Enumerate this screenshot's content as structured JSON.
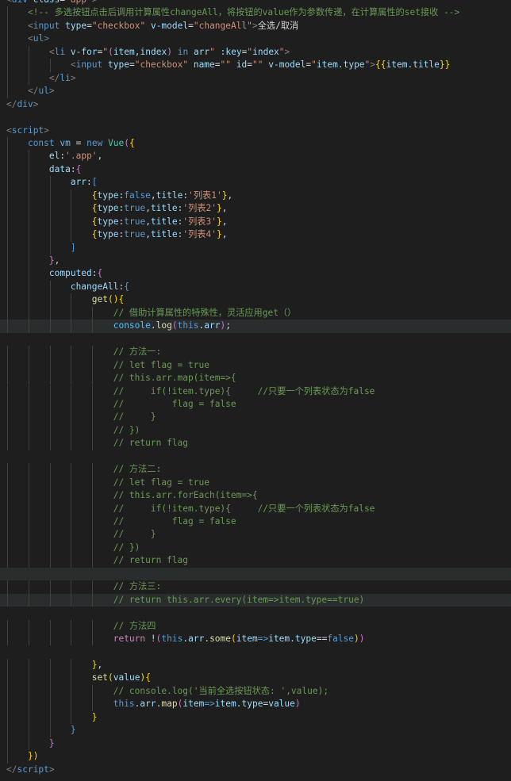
{
  "editor": {
    "theme_background": "#1e1e1e",
    "lines": [
      [
        [
          "t-bracket",
          "<"
        ],
        [
          "t-tag",
          "div"
        ],
        [
          "t-default",
          " "
        ],
        [
          "t-attr",
          "class"
        ],
        [
          "t-default",
          "="
        ],
        [
          "t-str",
          "\"app\""
        ],
        [
          "t-bracket",
          ">"
        ]
      ],
      [
        [
          "t-default",
          "    "
        ],
        [
          "t-comment",
          "<!-- 多选按钮点击后调用计算属性changeAll，将按钮的value作为参数传递，在计算属性的set接收 -->"
        ]
      ],
      [
        [
          "t-default",
          "    "
        ],
        [
          "t-bracket",
          "<"
        ],
        [
          "t-tag",
          "input"
        ],
        [
          "t-default",
          " "
        ],
        [
          "t-attr",
          "type"
        ],
        [
          "t-default",
          "="
        ],
        [
          "t-str",
          "\"checkbox\""
        ],
        [
          "t-default",
          " "
        ],
        [
          "t-attr",
          "v-model"
        ],
        [
          "t-default",
          "="
        ],
        [
          "t-str",
          "\"changeAll\""
        ],
        [
          "t-bracket",
          ">"
        ],
        [
          "t-text",
          "全选/取消"
        ]
      ],
      [
        [
          "t-default",
          "    "
        ],
        [
          "t-bracket",
          "<"
        ],
        [
          "t-tag",
          "ul"
        ],
        [
          "t-bracket",
          ">"
        ]
      ],
      [
        [
          "t-default",
          "        "
        ],
        [
          "t-bracket",
          "<"
        ],
        [
          "t-tag",
          "li"
        ],
        [
          "t-default",
          " "
        ],
        [
          "t-attr",
          "v-for"
        ],
        [
          "t-default",
          "="
        ],
        [
          "t-str",
          "\""
        ],
        [
          "t-paren",
          "("
        ],
        [
          "t-var",
          "item"
        ],
        [
          "t-punc",
          ","
        ],
        [
          "t-var",
          "index"
        ],
        [
          "t-paren",
          ")"
        ],
        [
          "t-default",
          " "
        ],
        [
          "t-keyword",
          "in"
        ],
        [
          "t-default",
          " "
        ],
        [
          "t-var",
          "arr"
        ],
        [
          "t-str",
          "\""
        ],
        [
          "t-default",
          " "
        ],
        [
          "t-attr",
          ":key"
        ],
        [
          "t-default",
          "="
        ],
        [
          "t-str",
          "\""
        ],
        [
          "t-var",
          "index"
        ],
        [
          "t-str",
          "\""
        ],
        [
          "t-bracket",
          ">"
        ]
      ],
      [
        [
          "t-default",
          "            "
        ],
        [
          "t-bracket",
          "<"
        ],
        [
          "t-tag",
          "input"
        ],
        [
          "t-default",
          " "
        ],
        [
          "t-attr",
          "type"
        ],
        [
          "t-default",
          "="
        ],
        [
          "t-str",
          "\"checkbox\""
        ],
        [
          "t-default",
          " "
        ],
        [
          "t-attr",
          "name"
        ],
        [
          "t-default",
          "="
        ],
        [
          "t-str",
          "\"\""
        ],
        [
          "t-default",
          " "
        ],
        [
          "t-attr",
          "id"
        ],
        [
          "t-default",
          "="
        ],
        [
          "t-str",
          "\"\""
        ],
        [
          "t-default",
          " "
        ],
        [
          "t-attr",
          "v-model"
        ],
        [
          "t-default",
          "="
        ],
        [
          "t-str",
          "\""
        ],
        [
          "t-var",
          "item"
        ],
        [
          "t-punc",
          "."
        ],
        [
          "t-prop",
          "type"
        ],
        [
          "t-str",
          "\""
        ],
        [
          "t-bracket",
          ">"
        ],
        [
          "t-brace",
          "{{"
        ],
        [
          "t-var",
          "item"
        ],
        [
          "t-punc",
          "."
        ],
        [
          "t-prop",
          "title"
        ],
        [
          "t-brace",
          "}}"
        ]
      ],
      [
        [
          "t-default",
          "        "
        ],
        [
          "t-bracket",
          "</"
        ],
        [
          "t-tag",
          "li"
        ],
        [
          "t-bracket",
          ">"
        ]
      ],
      [
        [
          "t-default",
          "    "
        ],
        [
          "t-bracket",
          "</"
        ],
        [
          "t-tag",
          "ul"
        ],
        [
          "t-bracket",
          ">"
        ]
      ],
      [
        [
          "t-bracket",
          "</"
        ],
        [
          "t-tag",
          "div"
        ],
        [
          "t-bracket",
          ">"
        ]
      ],
      [],
      [
        [
          "t-bracket",
          "<"
        ],
        [
          "t-tag",
          "script"
        ],
        [
          "t-bracket",
          ">"
        ]
      ],
      [
        [
          "t-default",
          "    "
        ],
        [
          "t-keyword",
          "const"
        ],
        [
          "t-default",
          " "
        ],
        [
          "t-const",
          "vm"
        ],
        [
          "t-default",
          " = "
        ],
        [
          "t-keyword",
          "new"
        ],
        [
          "t-default",
          " "
        ],
        [
          "t-class",
          "Vue"
        ],
        [
          "t-paren",
          "("
        ],
        [
          "t-brace",
          "{"
        ]
      ],
      [
        [
          "t-default",
          "        "
        ],
        [
          "t-prop",
          "el"
        ],
        [
          "t-punc",
          ":"
        ],
        [
          "t-str",
          "'.app'"
        ],
        [
          "t-punc",
          ","
        ]
      ],
      [
        [
          "t-default",
          "        "
        ],
        [
          "t-prop",
          "data"
        ],
        [
          "t-punc",
          ":"
        ],
        [
          "t-paren",
          "{"
        ]
      ],
      [
        [
          "t-default",
          "            "
        ],
        [
          "t-prop",
          "arr"
        ],
        [
          "t-punc",
          ":"
        ],
        [
          "t-tag",
          "["
        ]
      ],
      [
        [
          "t-default",
          "                "
        ],
        [
          "t-brace",
          "{"
        ],
        [
          "t-prop",
          "type"
        ],
        [
          "t-punc",
          ":"
        ],
        [
          "t-bool",
          "false"
        ],
        [
          "t-punc",
          ","
        ],
        [
          "t-prop",
          "title"
        ],
        [
          "t-punc",
          ":"
        ],
        [
          "t-str",
          "'列表1'"
        ],
        [
          "t-brace",
          "}"
        ],
        [
          "t-punc",
          ","
        ]
      ],
      [
        [
          "t-default",
          "                "
        ],
        [
          "t-brace",
          "{"
        ],
        [
          "t-prop",
          "type"
        ],
        [
          "t-punc",
          ":"
        ],
        [
          "t-bool",
          "true"
        ],
        [
          "t-punc",
          ","
        ],
        [
          "t-prop",
          "title"
        ],
        [
          "t-punc",
          ":"
        ],
        [
          "t-str",
          "'列表2'"
        ],
        [
          "t-brace",
          "}"
        ],
        [
          "t-punc",
          ","
        ]
      ],
      [
        [
          "t-default",
          "                "
        ],
        [
          "t-brace",
          "{"
        ],
        [
          "t-prop",
          "type"
        ],
        [
          "t-punc",
          ":"
        ],
        [
          "t-bool",
          "true"
        ],
        [
          "t-punc",
          ","
        ],
        [
          "t-prop",
          "title"
        ],
        [
          "t-punc",
          ":"
        ],
        [
          "t-str",
          "'列表3'"
        ],
        [
          "t-brace",
          "}"
        ],
        [
          "t-punc",
          ","
        ]
      ],
      [
        [
          "t-default",
          "                "
        ],
        [
          "t-brace",
          "{"
        ],
        [
          "t-prop",
          "type"
        ],
        [
          "t-punc",
          ":"
        ],
        [
          "t-bool",
          "true"
        ],
        [
          "t-punc",
          ","
        ],
        [
          "t-prop",
          "title"
        ],
        [
          "t-punc",
          ":"
        ],
        [
          "t-str",
          "'列表4'"
        ],
        [
          "t-brace",
          "}"
        ],
        [
          "t-punc",
          ","
        ]
      ],
      [
        [
          "t-default",
          "            "
        ],
        [
          "t-tag",
          "]"
        ]
      ],
      [
        [
          "t-default",
          "        "
        ],
        [
          "t-paren",
          "}"
        ],
        [
          "t-punc",
          ","
        ]
      ],
      [
        [
          "t-default",
          "        "
        ],
        [
          "t-prop",
          "computed"
        ],
        [
          "t-punc",
          ":"
        ],
        [
          "t-paren",
          "{"
        ]
      ],
      [
        [
          "t-default",
          "            "
        ],
        [
          "t-prop",
          "changeAll"
        ],
        [
          "t-punc",
          ":"
        ],
        [
          "t-tag",
          "{"
        ]
      ],
      [
        [
          "t-default",
          "                "
        ],
        [
          "t-func",
          "get"
        ],
        [
          "t-brace",
          "()"
        ],
        [
          "t-brace",
          "{"
        ]
      ],
      [
        [
          "t-default",
          "                    "
        ],
        [
          "t-comment",
          "// 借助计算属性的特殊性，灵活应用get（）"
        ]
      ],
      [
        [
          "t-default",
          "                    "
        ],
        [
          "t-const",
          "console"
        ],
        [
          "t-punc",
          "."
        ],
        [
          "t-func",
          "log"
        ],
        [
          "t-paren",
          "("
        ],
        [
          "t-this",
          "this"
        ],
        [
          "t-punc",
          "."
        ],
        [
          "t-prop",
          "arr"
        ],
        [
          "t-paren",
          ")"
        ],
        [
          "t-punc",
          ";"
        ]
      ],
      [],
      [
        [
          "t-default",
          "                    "
        ],
        [
          "t-comment",
          "// 方法一:"
        ]
      ],
      [
        [
          "t-default",
          "                    "
        ],
        [
          "t-comment",
          "// let flag = true"
        ]
      ],
      [
        [
          "t-default",
          "                    "
        ],
        [
          "t-comment",
          "// this.arr.map(item=>{"
        ]
      ],
      [
        [
          "t-default",
          "                    "
        ],
        [
          "t-comment",
          "//     if(!item.type){     //只要一个列表状态为false"
        ]
      ],
      [
        [
          "t-default",
          "                    "
        ],
        [
          "t-comment",
          "//         flag = false"
        ]
      ],
      [
        [
          "t-default",
          "                    "
        ],
        [
          "t-comment",
          "//     }"
        ]
      ],
      [
        [
          "t-default",
          "                    "
        ],
        [
          "t-comment",
          "// })"
        ]
      ],
      [
        [
          "t-default",
          "                    "
        ],
        [
          "t-comment",
          "// return flag"
        ]
      ],
      [],
      [
        [
          "t-default",
          "                    "
        ],
        [
          "t-comment",
          "// 方法二:"
        ]
      ],
      [
        [
          "t-default",
          "                    "
        ],
        [
          "t-comment",
          "// let flag = true"
        ]
      ],
      [
        [
          "t-default",
          "                    "
        ],
        [
          "t-comment",
          "// this.arr.forEach(item=>{"
        ]
      ],
      [
        [
          "t-default",
          "                    "
        ],
        [
          "t-comment",
          "//     if(!item.type){     //只要一个列表状态为false"
        ]
      ],
      [
        [
          "t-default",
          "                    "
        ],
        [
          "t-comment",
          "//         flag = false"
        ]
      ],
      [
        [
          "t-default",
          "                    "
        ],
        [
          "t-comment",
          "//     }"
        ]
      ],
      [
        [
          "t-default",
          "                    "
        ],
        [
          "t-comment",
          "// })"
        ]
      ],
      [
        [
          "t-default",
          "                    "
        ],
        [
          "t-comment",
          "// return flag"
        ]
      ],
      [],
      [
        [
          "t-default",
          "                    "
        ],
        [
          "t-comment",
          "// 方法三:"
        ]
      ],
      [
        [
          "t-default",
          "                    "
        ],
        [
          "t-comment",
          "// return this.arr.every(item=>item.type==true)"
        ]
      ],
      [],
      [
        [
          "t-default",
          "                    "
        ],
        [
          "t-comment",
          "// 方法四"
        ]
      ],
      [
        [
          "t-default",
          "                    "
        ],
        [
          "t-control",
          "return"
        ],
        [
          "t-default",
          " "
        ],
        [
          "t-punc",
          "!"
        ],
        [
          "t-paren",
          "("
        ],
        [
          "t-this",
          "this"
        ],
        [
          "t-punc",
          "."
        ],
        [
          "t-prop",
          "arr"
        ],
        [
          "t-punc",
          "."
        ],
        [
          "t-func",
          "some"
        ],
        [
          "t-brace",
          "("
        ],
        [
          "t-var",
          "item"
        ],
        [
          "t-keyword",
          "=>"
        ],
        [
          "t-var",
          "item"
        ],
        [
          "t-punc",
          "."
        ],
        [
          "t-prop",
          "type"
        ],
        [
          "t-punc",
          "=="
        ],
        [
          "t-bool",
          "false"
        ],
        [
          "t-brace",
          ")"
        ],
        [
          "t-paren",
          ")"
        ]
      ],
      [],
      [
        [
          "t-default",
          "                "
        ],
        [
          "t-brace",
          "}"
        ],
        [
          "t-punc",
          ","
        ]
      ],
      [
        [
          "t-default",
          "                "
        ],
        [
          "t-func",
          "set"
        ],
        [
          "t-brace",
          "("
        ],
        [
          "t-var",
          "value"
        ],
        [
          "t-brace",
          ")"
        ],
        [
          "t-brace",
          "{"
        ]
      ],
      [
        [
          "t-default",
          "                    "
        ],
        [
          "t-comment",
          "// console.log('当前全选按钮状态: ',value);"
        ]
      ],
      [
        [
          "t-default",
          "                    "
        ],
        [
          "t-this",
          "this"
        ],
        [
          "t-punc",
          "."
        ],
        [
          "t-prop",
          "arr"
        ],
        [
          "t-punc",
          "."
        ],
        [
          "t-func",
          "map"
        ],
        [
          "t-paren",
          "("
        ],
        [
          "t-var",
          "item"
        ],
        [
          "t-keyword",
          "=>"
        ],
        [
          "t-var",
          "item"
        ],
        [
          "t-punc",
          "."
        ],
        [
          "t-prop",
          "type"
        ],
        [
          "t-punc",
          "="
        ],
        [
          "t-var",
          "value"
        ],
        [
          "t-paren",
          ")"
        ]
      ],
      [
        [
          "t-default",
          "                "
        ],
        [
          "t-brace",
          "}"
        ]
      ],
      [
        [
          "t-default",
          "            "
        ],
        [
          "t-tag",
          "}"
        ]
      ],
      [
        [
          "t-default",
          "        "
        ],
        [
          "t-paren",
          "}"
        ]
      ],
      [
        [
          "t-default",
          "    "
        ],
        [
          "t-brace",
          "})"
        ]
      ],
      [
        [
          "t-bracket",
          "</"
        ],
        [
          "t-tag",
          "script"
        ],
        [
          "t-bracket",
          ">"
        ]
      ]
    ]
  }
}
